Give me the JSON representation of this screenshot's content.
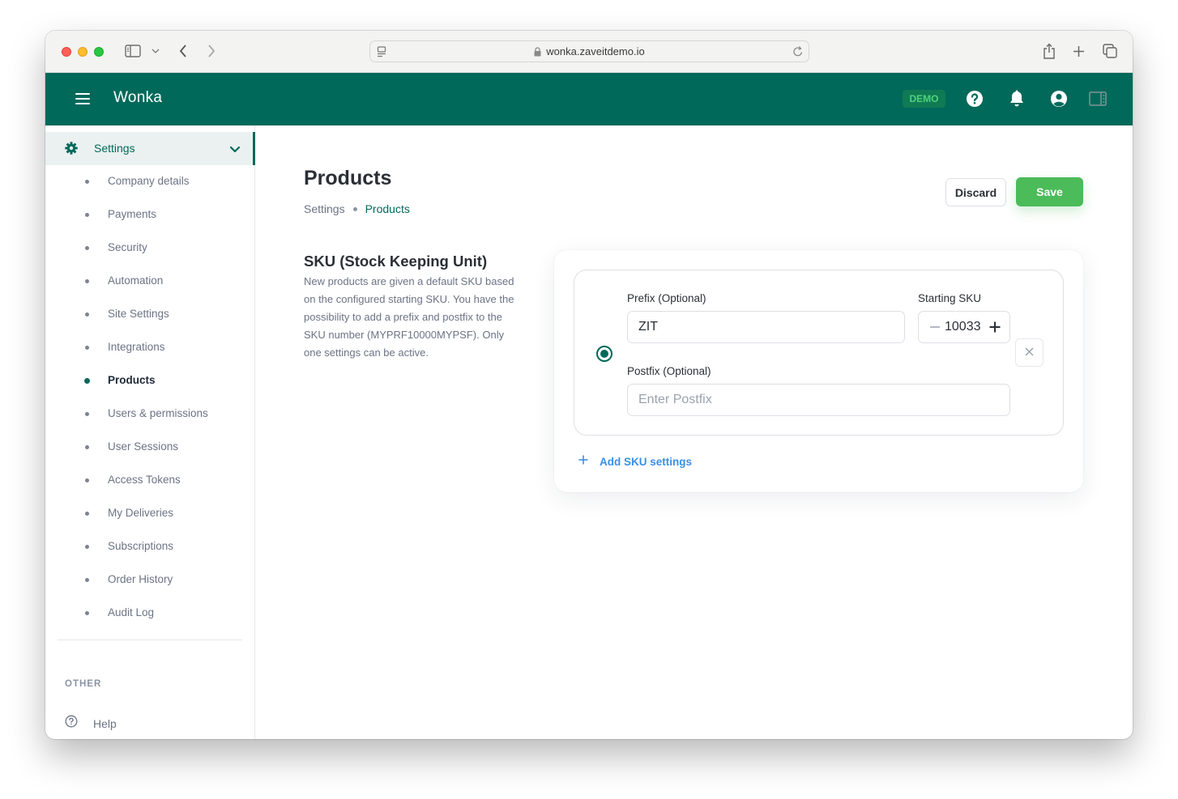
{
  "browser": {
    "url": "wonka.zaveitdemo.io",
    "icons": [
      "sidebar-toggle-icon",
      "chevron-down-icon",
      "back-icon",
      "forward-icon",
      "reader-icon",
      "lock-icon",
      "reload-icon",
      "share-icon",
      "new-tab-icon",
      "tabs-overview-icon"
    ]
  },
  "header": {
    "app_title": "Wonka",
    "badge": "DEMO",
    "icons": [
      "menu-icon",
      "help-icon",
      "bell-icon",
      "account-icon",
      "panel-icon"
    ]
  },
  "sidebar": {
    "section": {
      "label": "Settings",
      "icon": "gear-icon",
      "expanded": true
    },
    "items": [
      {
        "label": "Company details",
        "active": false
      },
      {
        "label": "Payments",
        "active": false
      },
      {
        "label": "Security",
        "active": false
      },
      {
        "label": "Automation",
        "active": false
      },
      {
        "label": "Site Settings",
        "active": false
      },
      {
        "label": "Integrations",
        "active": false
      },
      {
        "label": "Products",
        "active": true
      },
      {
        "label": "Users & permissions",
        "active": false
      },
      {
        "label": "User Sessions",
        "active": false
      },
      {
        "label": "Access Tokens",
        "active": false
      },
      {
        "label": "My Deliveries",
        "active": false
      },
      {
        "label": "Subscriptions",
        "active": false
      },
      {
        "label": "Order History",
        "active": false
      },
      {
        "label": "Audit Log",
        "active": false
      }
    ],
    "other_heading": "OTHER",
    "help_label": "Help"
  },
  "main": {
    "title": "Products",
    "breadcrumb": [
      "Settings",
      "Products"
    ],
    "discard_label": "Discard",
    "save_label": "Save",
    "sku_section": {
      "heading": "SKU (Stock Keeping Unit)",
      "description": "New products are given a default SKU based on the configured starting SKU. You have the possibility to add a prefix and postfix to the SKU number (MYPRF10000MYPSF). Only one settings can be active."
    },
    "sku_settings": [
      {
        "selected": true,
        "prefix_label": "Prefix (Optional)",
        "prefix_value": "ZIT",
        "starting_sku_label": "Starting SKU",
        "starting_sku_value": "10033",
        "postfix_label": "Postfix (Optional)",
        "postfix_value": "",
        "postfix_placeholder": "Enter Postfix"
      }
    ],
    "add_sku_label": "Add SKU settings"
  },
  "colors": {
    "brand": "#00695a",
    "save": "#4cbb5a",
    "link": "#3b8fe6",
    "demo_badge_text": "#4fd27a"
  }
}
